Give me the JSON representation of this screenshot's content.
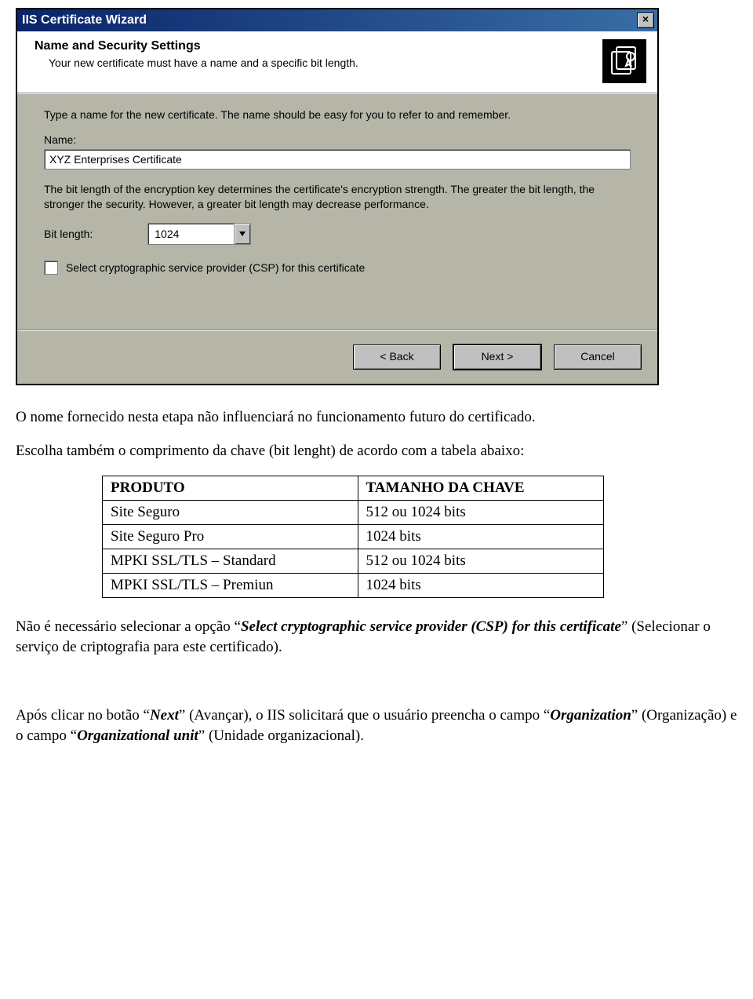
{
  "dialog": {
    "title": "IIS Certificate Wizard",
    "close_glyph": "×",
    "header_title": "Name and Security Settings",
    "header_desc": "Your new certificate must have a name and a specific bit length.",
    "instructions": "Type a name for the new certificate. The name should be easy for you to refer to and remember.",
    "name_label": "Name:",
    "name_value": "XYZ Enterprises Certificate",
    "bits_desc": "The bit length of the encryption key determines the certificate's encryption strength. The greater the bit length, the stronger the security. However, a greater bit length may decrease performance.",
    "bitlength_label": "Bit length:",
    "bitlength_value": "1024",
    "csp_label": "Select cryptographic service provider (CSP) for this certificate",
    "btn_back": "< Back",
    "btn_next": "Next >",
    "btn_cancel": "Cancel"
  },
  "doc": {
    "p1": "O nome fornecido nesta etapa não influenciará no funcionamento futuro do certificado.",
    "p2": "Escolha também o comprimento da chave (bit lenght) de acordo com a tabela abaixo:",
    "table": {
      "headers": {
        "c1": "PRODUTO",
        "c2": "TAMANHO DA CHAVE"
      },
      "rows": [
        {
          "c1": "Site Seguro",
          "c2": "512 ou 1024 bits"
        },
        {
          "c1": "Site Seguro Pro",
          "c2": "1024 bits"
        },
        {
          "c1": "MPKI SSL/TLS – Standard",
          "c2": "512 ou 1024 bits"
        },
        {
          "c1": "MPKI SSL/TLS – Premiun",
          "c2": "1024 bits"
        }
      ]
    },
    "p3_a": "Não é necessário selecionar a opção “",
    "p3_b": "Select cryptographic service provider (CSP) for this certificate",
    "p3_c": "” (Selecionar o serviço de criptografia para este certificado).",
    "p4_a": "Após clicar no botão “",
    "p4_b": "Next",
    "p4_c": "” (Avançar), o IIS solicitará que o usuário preencha o campo “",
    "p4_d": "Organization",
    "p4_e": "” (Organização) e o campo “",
    "p4_f": "Organizational unit",
    "p4_g": "” (Unidade organizacional)."
  }
}
